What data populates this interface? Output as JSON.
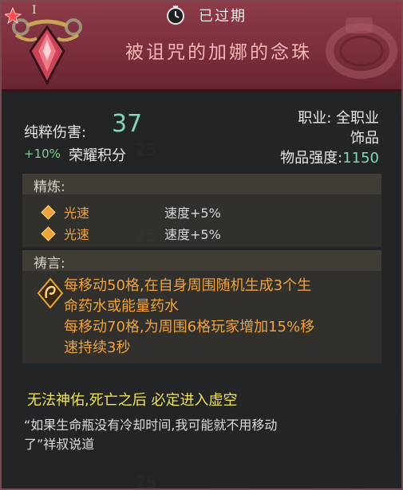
{
  "header": {
    "tier": "I",
    "status_text": "已过期",
    "item_name": "被诅咒的加娜的念珠"
  },
  "stats": {
    "damage_label": "纯粹伤害:",
    "damage_value": "37",
    "bonus_text": "+10%",
    "bonus_label": "荣耀积分",
    "class_text": "职业: 全职业",
    "type_text": "饰品",
    "strength_label": "物品强度:",
    "strength_value": "1150"
  },
  "refine": {
    "title": "精炼:",
    "rows": [
      {
        "name": "光速",
        "value": "速度+5%"
      },
      {
        "name": "光速",
        "value": "速度+5%"
      }
    ]
  },
  "prayer": {
    "title": "祷言:",
    "lines": [
      "每移动50格,在自身周围随机生成3个生",
      "命药水或能量药水",
      "每移动70格,为周围6格玩家增加15%移",
      "速持续3秒"
    ]
  },
  "footer": {
    "yellow_text": "无法神佑,死亡之后 必定进入虚空",
    "flavor_line1": "“如果生命瓶没有冷却时间,我可能就不用移动",
    "flavor_line2": "了”祥叔说道"
  },
  "background": {
    "slot_numbers": [
      "25",
      "25",
      "25"
    ]
  },
  "colors": {
    "header_bg": "#8d3b49",
    "name": "#f4b6b6",
    "value_teal": "#7fd6b9",
    "orange": "#f0a33d",
    "yellow": "#f1e35a"
  }
}
